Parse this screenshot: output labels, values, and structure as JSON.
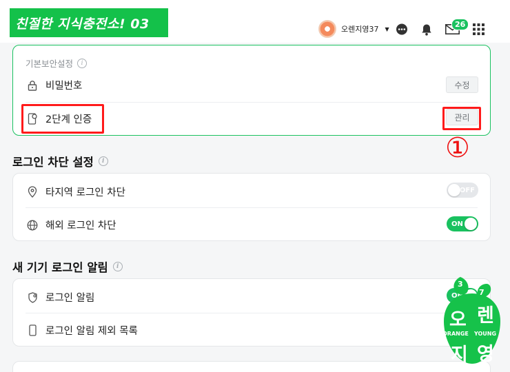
{
  "header": {
    "brand_title": "친절한 지식충전소! 03",
    "username": "오렌지영37",
    "mail_count": "26"
  },
  "basic_security": {
    "section_title": "기본보안설정",
    "password_label": "비밀번호",
    "password_button": "수정",
    "twofactor_label": "2단계 인증",
    "twofactor_button": "관리"
  },
  "annotation": {
    "marker": "①",
    "color": "#ff1a1a"
  },
  "login_block": {
    "section_title": "로그인 차단 설정",
    "region_label": "타지역 로그인 차단",
    "region_toggle": "OFF",
    "overseas_label": "해외 로그인 차단",
    "overseas_toggle": "ON"
  },
  "new_device": {
    "section_title": "새 기기 로그인 알림",
    "alert_label": "로그인 알림",
    "alert_toggle": "ON",
    "exclude_label": "로그인 알림 제외 목록"
  },
  "watermark": {
    "top_left": "3",
    "top_right": "7",
    "syllable_1": "오",
    "syllable_2": "렌",
    "text_left": "ORANGE",
    "text_right": "YOUNG",
    "syllable_3": "지",
    "syllable_4": "영"
  },
  "colors": {
    "brand_green": "#14c14a",
    "toggle_on": "#19c15f",
    "toggle_off": "#e5e7ea"
  }
}
